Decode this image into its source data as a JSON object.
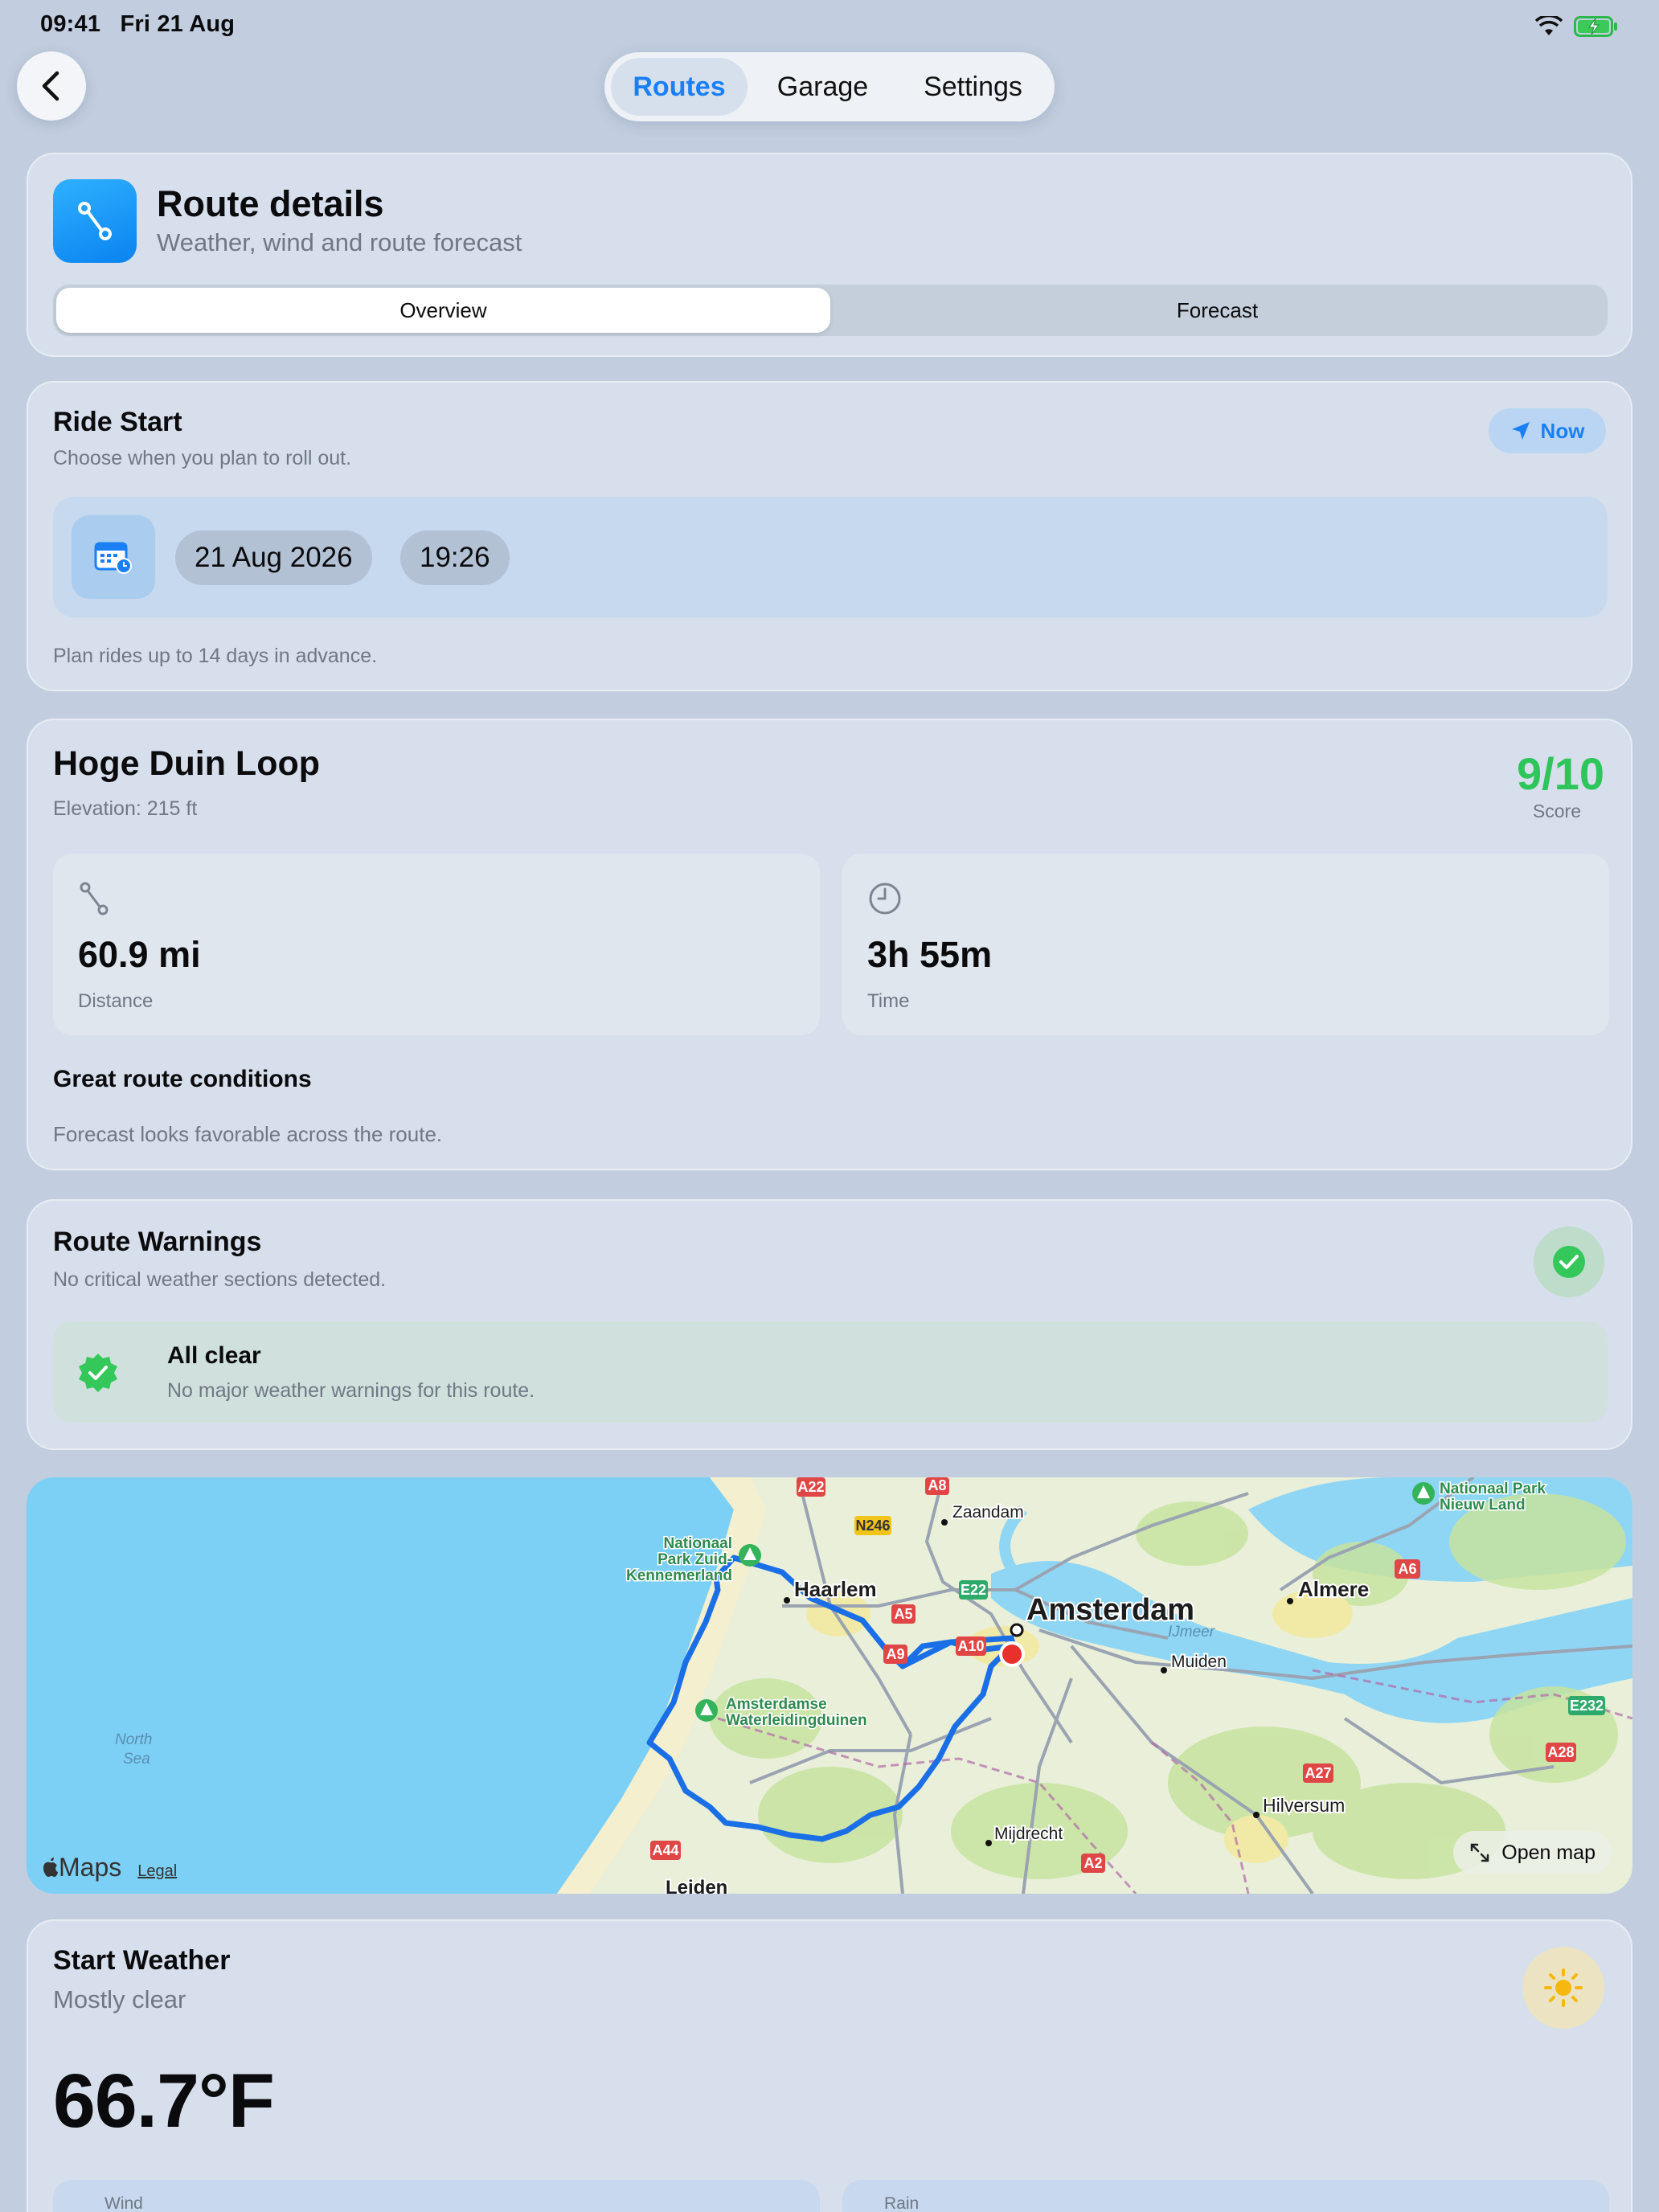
{
  "status_bar": {
    "time": "09:41",
    "date": "Fri 21 Aug"
  },
  "nav": {
    "tabs": [
      "Routes",
      "Garage",
      "Settings"
    ],
    "active_tab": "Routes"
  },
  "header": {
    "title": "Route details",
    "subtitle": "Weather, wind and route forecast",
    "segments": [
      "Overview",
      "Forecast"
    ],
    "active_segment": "Overview"
  },
  "ride_start": {
    "title": "Ride Start",
    "subtitle": "Choose when you plan to roll out.",
    "now_label": "Now",
    "date": "21 Aug 2026",
    "time": "19:26",
    "note": "Plan rides up to 14 days in advance."
  },
  "route": {
    "name": "Hoge Duin Loop",
    "elevation": "Elevation: 215 ft",
    "score": "9/10",
    "score_label": "Score",
    "distance_value": "60.9 mi",
    "distance_label": "Distance",
    "time_value": "3h 55m",
    "time_label": "Time",
    "conditions_title": "Great route conditions",
    "conditions_text": "Forecast looks favorable across the route."
  },
  "warnings": {
    "title": "Route Warnings",
    "subtitle": "No critical weather sections detected.",
    "status_title": "All clear",
    "status_text": "No major weather warnings for this route."
  },
  "map": {
    "labels": {
      "amsterdam": "Amsterdam",
      "haarlem": "Haarlem",
      "zaandam": "Zaandam",
      "almere": "Almere",
      "muiden": "Muiden",
      "hilversum": "Hilversum",
      "mijdrecht": "Mijdrecht",
      "leiden": "Leiden",
      "ijmeer": "IJmeer",
      "north_sea_1": "North",
      "north_sea_2": "Sea",
      "park1_1": "Nationaal",
      "park1_2": "Park Zuid-",
      "park1_3": "Kennemerland",
      "park2_1": "Amsterdamse",
      "park2_2": "Waterleidingduinen",
      "park3_1": "Nationaal Park",
      "park3_2": "Nieuw Land"
    },
    "road_signs": {
      "a22": "A22",
      "a8": "A8",
      "n246": "N246",
      "e22": "E22",
      "a5": "A5",
      "a9": "A9",
      "a10": "A10",
      "a6": "A6",
      "e232": "E232",
      "a27": "A27",
      "a28": "A28",
      "a44": "A44",
      "a2": "A2"
    },
    "brand": "Maps",
    "legal": "Legal",
    "open_label": "Open map"
  },
  "start_weather": {
    "title": "Start Weather",
    "condition": "Mostly clear",
    "temperature": "66.7°F",
    "wind_label": "Wind",
    "rain_label": "Rain"
  },
  "colors": {
    "accent": "#1a7ff5",
    "score": "#2ec55a",
    "route_line": "#1b6fe6",
    "water": "#7ccff5",
    "land": "#e9efd9"
  }
}
